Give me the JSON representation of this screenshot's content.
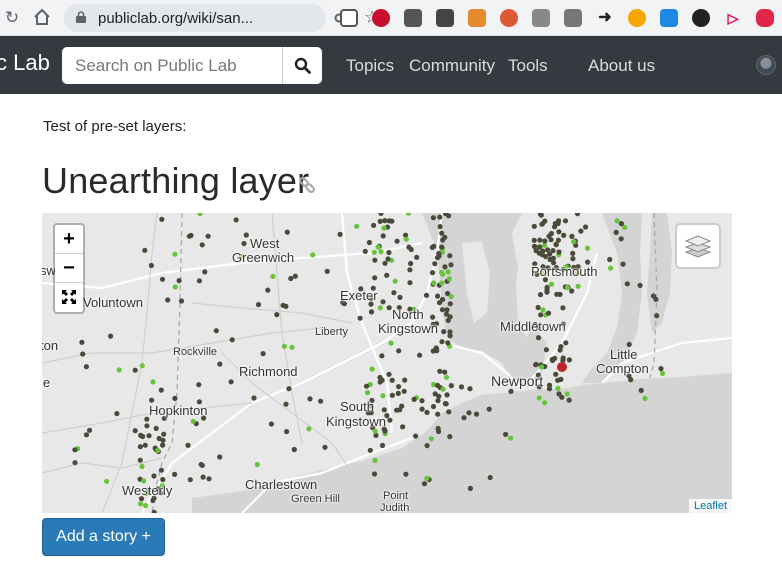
{
  "browser": {
    "url": "publiclab.org/wiki/san..."
  },
  "navbar": {
    "brand": "c Lab",
    "search_placeholder": "Search on Public Lab",
    "links": [
      "Topics",
      "Community",
      "Tools",
      "About us"
    ]
  },
  "page": {
    "intro": "Test of pre-set layers:",
    "title": "Unearthing layer"
  },
  "map": {
    "places": {
      "west_greenwich_1": "West",
      "west_greenwich_2": "Greenwich",
      "exeter": "Exeter",
      "north_kingstown_1": "North",
      "north_kingstown_2": "Kingstown",
      "voluntown": "Voluntown",
      "liberty": "Liberty",
      "rockville": "Rockville",
      "richmond": "Richmond",
      "south_kingstown_1": "South",
      "south_kingstown_2": "Kingstown",
      "hopkinton": "Hopkinton",
      "westerly": "Westerly",
      "charlestown": "Charlestown",
      "green_hill": "Green Hill",
      "point_judith_1": "Point",
      "point_judith_2": "Judith",
      "portsmouth": "Portsmouth",
      "middletown": "Middletown",
      "newport": "Newport",
      "little_compton_1": "Little",
      "little_compton_2": "Compton",
      "edge_sw": "sw",
      "edge_ton": "ton",
      "edge_le": "le"
    },
    "attribution": "Leaflet",
    "colors": {
      "dark_marker": "#4a4a3a",
      "green_marker": "#66c43a",
      "red_marker": "#c0242b",
      "water": "#d4d4d4",
      "land": "#e8e8e8"
    }
  },
  "actions": {
    "add_story": "Add a story +"
  }
}
